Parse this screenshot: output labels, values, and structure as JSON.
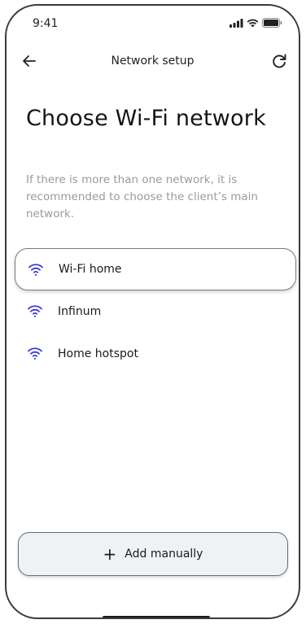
{
  "status_bar": {
    "time": "9:41",
    "icons": [
      "signal-icon",
      "wifi-icon",
      "battery-icon"
    ]
  },
  "nav": {
    "title": "Network setup",
    "back_icon": "arrow-left-icon",
    "refresh_icon": "refresh-icon"
  },
  "page": {
    "title": "Choose Wi-Fi network",
    "hint": "If there is more than one network, it is recommended to choose the client’s main network."
  },
  "networks": [
    {
      "label": "Wi-Fi home",
      "selected": true
    },
    {
      "label": "Infinum",
      "selected": false
    },
    {
      "label": "Home hotspot",
      "selected": false
    }
  ],
  "add_manually": {
    "label": "Add manually",
    "icon": "plus-icon"
  },
  "colors": {
    "wifi_accent": "#3b3bd6",
    "button_bg": "#eef2f5",
    "hint_text": "#9a9a9a"
  }
}
